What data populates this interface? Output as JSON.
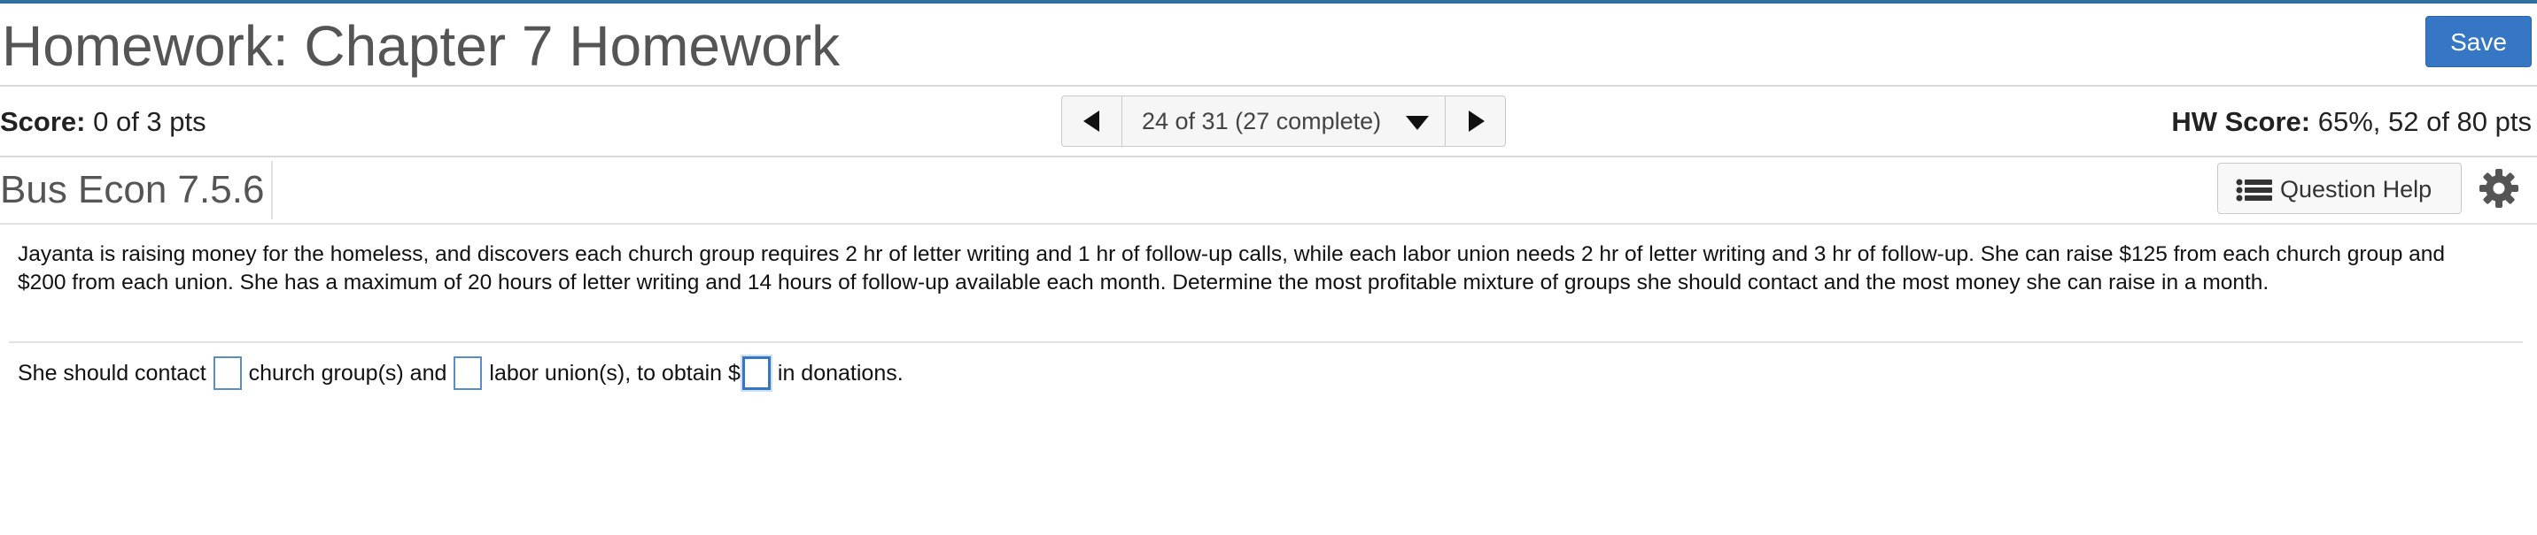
{
  "header": {
    "title": "Homework: Chapter 7 Homework",
    "save_label": "Save"
  },
  "score_bar": {
    "score_label": "Score:",
    "score_value": "0 of 3 pts",
    "hw_score_label": "HW Score:",
    "hw_score_value": "65%, 52 of 80 pts",
    "navigator": {
      "position_text": "24 of 31 (27 complete)",
      "prev_icon": "triangle-left-icon",
      "next_icon": "triangle-right-icon",
      "dropdown_icon": "caret-down-icon"
    }
  },
  "question_bar": {
    "question_id": "Bus Econ 7.5.6",
    "help_label": "Question Help",
    "help_icon": "list-icon",
    "settings_icon": "gear-icon"
  },
  "problem": {
    "text": "Jayanta is raising money for the homeless, and discovers each church group requires 2 hr of letter writing and 1 hr of follow-up calls, while each labor union needs 2 hr of letter writing and 3 hr of follow-up. She can raise $125 from each church group and $200 from each union. She has a maximum of 20 hours of letter writing and 14 hours of follow-up available each month. Determine the most profitable mixture of groups she should contact and the most money she can raise in a month."
  },
  "answer": {
    "part1": "She should contact",
    "part2": "church group(s) and",
    "part3": "labor union(s), to obtain $",
    "part4": "in donations.",
    "church_value": "",
    "union_value": "",
    "donation_value": ""
  },
  "colors": {
    "accent": "#3577c4",
    "top_border": "#2f6f9f"
  }
}
